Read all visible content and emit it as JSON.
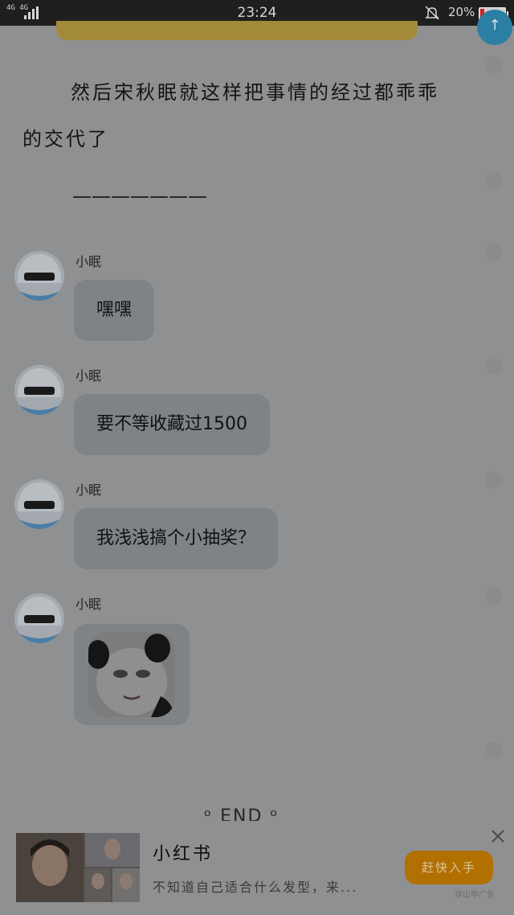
{
  "status_bar": {
    "network": "4G 4G",
    "time": "23:24",
    "battery_percent": "20%",
    "battery_level": 0.2,
    "colors": {
      "bar": "#1f1f1f",
      "battery_low": "#d32020"
    }
  },
  "story": {
    "paragraph": "然后宋秋眠就这样把事情的经过都乖乖的交代了",
    "divider": "———————"
  },
  "messages": [
    {
      "name": "小眠",
      "text": "嘿嘿",
      "type": "text"
    },
    {
      "name": "小眠",
      "text": "要不等收藏过1500",
      "type": "text"
    },
    {
      "name": "小眠",
      "text": "我浅浅搞个小抽奖？",
      "type": "text"
    },
    {
      "name": "小眠",
      "text": "",
      "type": "sticker",
      "sticker": "panda-meme-sticker"
    }
  ],
  "end_mark": "END",
  "ad": {
    "title": "小红书",
    "description": "不知道自己适合什么发型，来...",
    "cta": "赶快入手",
    "tag": "穿山甲广告",
    "close_icon": "close-icon",
    "cta_color": "#b27000"
  }
}
